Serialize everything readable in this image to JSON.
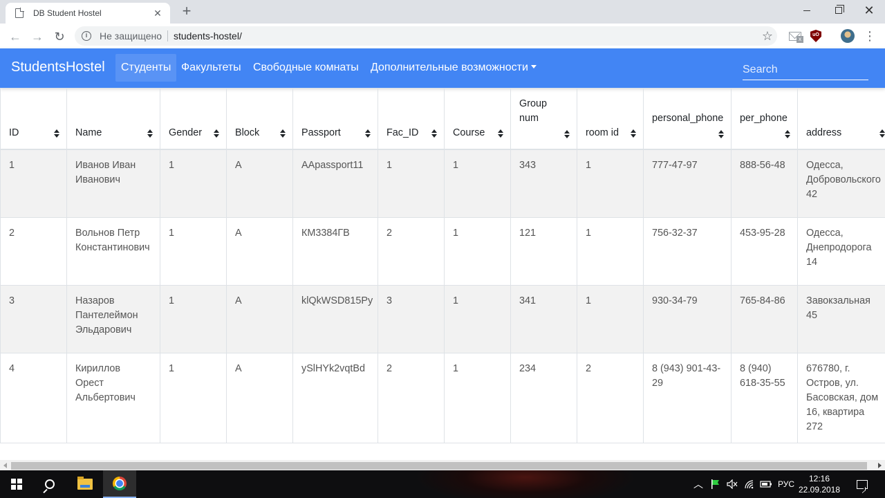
{
  "browser": {
    "tab_title": "DB Student Hostel",
    "tab_close": "✕",
    "new_tab": "+",
    "not_secure": "Не защищено",
    "url": "students-hostel/"
  },
  "app": {
    "brand": "StudentsHostel",
    "nav": [
      {
        "label": "Студенты",
        "active": true
      },
      {
        "label": "Факультеты",
        "active": false
      },
      {
        "label": "Свободные комнаты",
        "active": false
      },
      {
        "label": "Дополнительные возможности",
        "active": false
      }
    ],
    "search_placeholder": "Search",
    "accent_color": "#4285f4"
  },
  "table": {
    "columns": [
      "ID",
      "Name",
      "Gender",
      "Block",
      "Passport",
      "Fac_ID",
      "Course",
      "Group num",
      "room id",
      "personal_phone",
      "per_phone",
      "address"
    ],
    "rows": [
      [
        "1",
        "Иванов Иван Иванович",
        "1",
        "A",
        "AApassport11",
        "1",
        "1",
        "343",
        "1",
        "777-47-97",
        "888-56-48",
        "Одесса, Добровольского 42"
      ],
      [
        "2",
        "Вольнов Петр Константинович",
        "1",
        "A",
        "КМ3384ГВ",
        "2",
        "1",
        "121",
        "1",
        "756-32-37",
        "453-95-28",
        "Одесса, Днепродорога 14"
      ],
      [
        "3",
        "Назаров Пантелеймон Эльдарович",
        "1",
        "A",
        "klQkWSD815Py",
        "3",
        "1",
        "341",
        "1",
        "930-34-79",
        "765-84-86",
        "Завокзальная 45"
      ],
      [
        "4",
        "Кириллов Орест Альбертович",
        "1",
        "A",
        "ySlHYk2vqtBd",
        "2",
        "1",
        "234",
        "2",
        "8 (943) 901-43-29",
        "8 (940) 618-35-55",
        "676780, г. Остров, ул. Басовская, дом 16, квартира 272"
      ]
    ]
  },
  "taskbar": {
    "language": "РУС",
    "time": "12:16",
    "date": "22.09.2018"
  }
}
